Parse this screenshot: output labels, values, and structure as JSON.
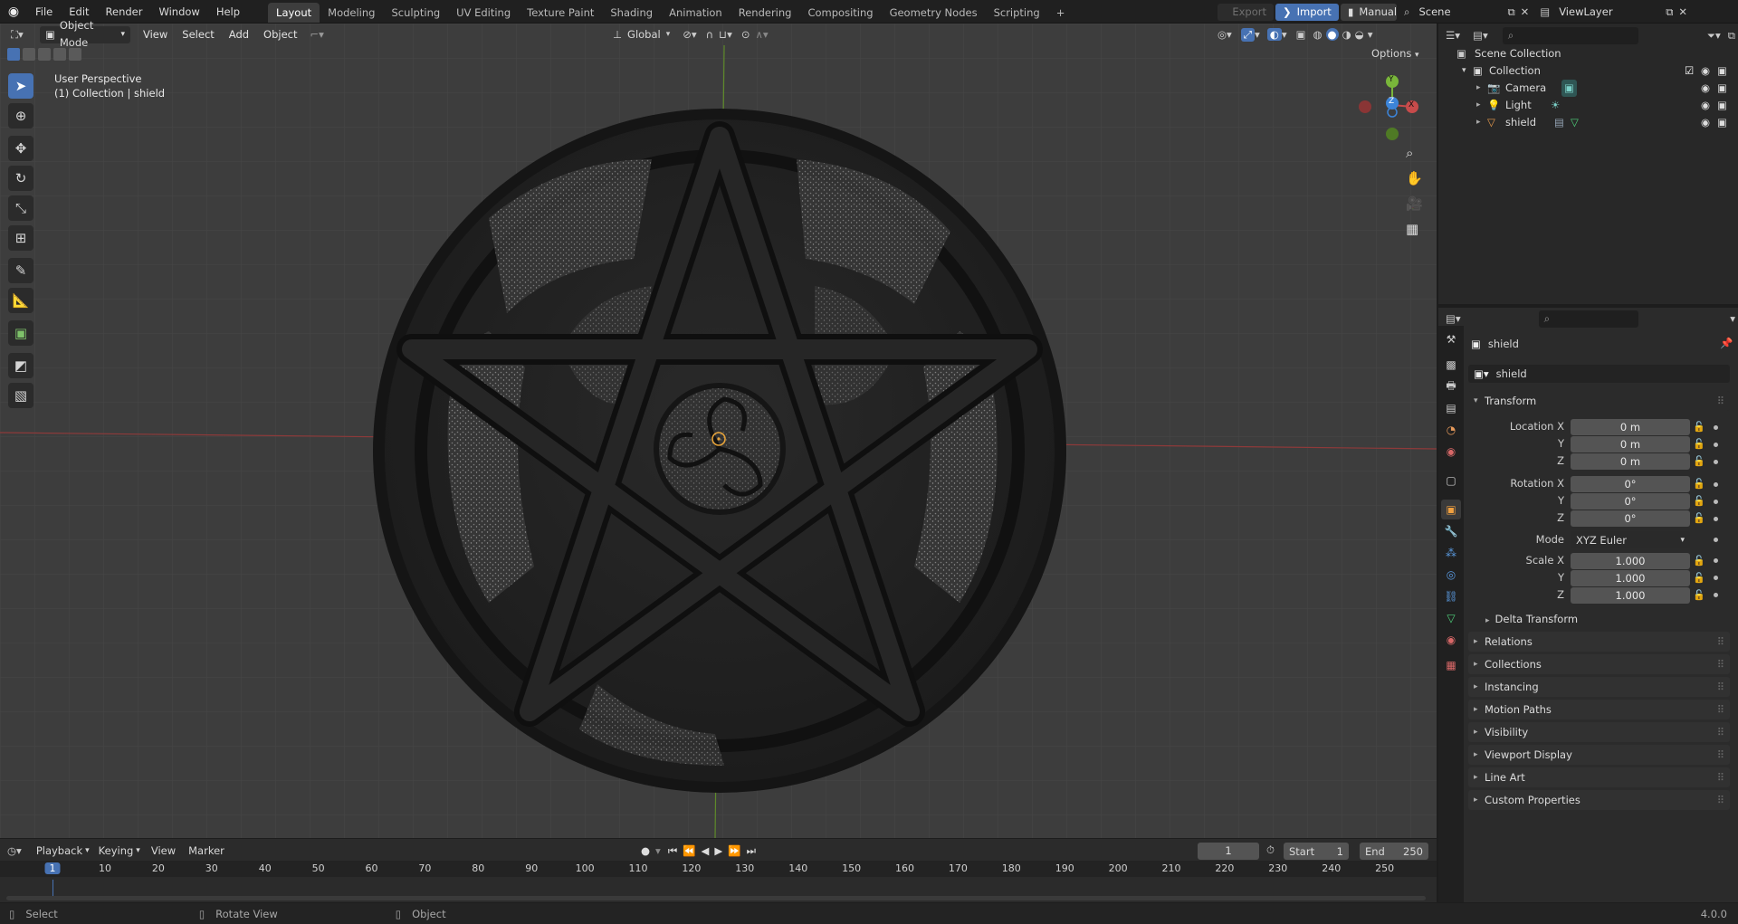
{
  "topbar": {
    "menus": [
      "File",
      "Edit",
      "Render",
      "Window",
      "Help"
    ],
    "workspaces": [
      "Layout",
      "Modeling",
      "Sculpting",
      "UV Editing",
      "Texture Paint",
      "Shading",
      "Animation",
      "Rendering",
      "Compositing",
      "Geometry Nodes",
      "Scripting"
    ],
    "active_workspace": "Layout",
    "add_tab": "+",
    "export_label": "Export",
    "import_label": "Import",
    "manual_label": "Manual",
    "scene_name": "Scene",
    "view_layer": "ViewLayer"
  },
  "viewport_header": {
    "mode": "Object Mode",
    "menus": [
      "View",
      "Select",
      "Add",
      "Object"
    ],
    "transform_orientation": "Global",
    "options_label": "Options"
  },
  "viewport": {
    "perspective": "User Perspective",
    "collection_info": "(1) Collection | shield",
    "gizmo_axes": {
      "x": "X",
      "y": "Y",
      "z": "Z"
    }
  },
  "outliner": {
    "root": "Scene Collection",
    "collection": "Collection",
    "items": [
      "Camera",
      "Light",
      "shield"
    ]
  },
  "properties": {
    "object_name": "shield",
    "datablock_name": "shield",
    "transform_header": "Transform",
    "location_labels": [
      "Location X",
      "Y",
      "Z"
    ],
    "location_values": [
      "0 m",
      "0 m",
      "0 m"
    ],
    "rotation_labels": [
      "Rotation X",
      "Y",
      "Z"
    ],
    "rotation_values": [
      "0°",
      "0°",
      "0°"
    ],
    "mode_label": "Mode",
    "mode_value": "XYZ Euler",
    "scale_labels": [
      "Scale X",
      "Y",
      "Z"
    ],
    "scale_values": [
      "1.000",
      "1.000",
      "1.000"
    ],
    "delta_transform": "Delta Transform",
    "panels": [
      "Relations",
      "Collections",
      "Instancing",
      "Motion Paths",
      "Visibility",
      "Viewport Display",
      "Line Art",
      "Custom Properties"
    ]
  },
  "timeline": {
    "menus": [
      "Playback",
      "Keying",
      "View",
      "Marker"
    ],
    "current_frame": "1",
    "start_label": "Start",
    "start_value": "1",
    "end_label": "End",
    "end_value": "250",
    "ticks": [
      "1",
      "10",
      "20",
      "30",
      "40",
      "50",
      "60",
      "70",
      "80",
      "90",
      "100",
      "110",
      "120",
      "130",
      "140",
      "150",
      "160",
      "170",
      "180",
      "190",
      "200",
      "210",
      "220",
      "230",
      "240",
      "250"
    ]
  },
  "statusbar": {
    "select": "Select",
    "rotate": "Rotate View",
    "object": "Object",
    "version": "4.0.0"
  },
  "colors": {
    "accent": "#4772b3",
    "x_axis": "#c84b4b",
    "y_axis": "#79b63a",
    "z_axis": "#3c84d8"
  }
}
